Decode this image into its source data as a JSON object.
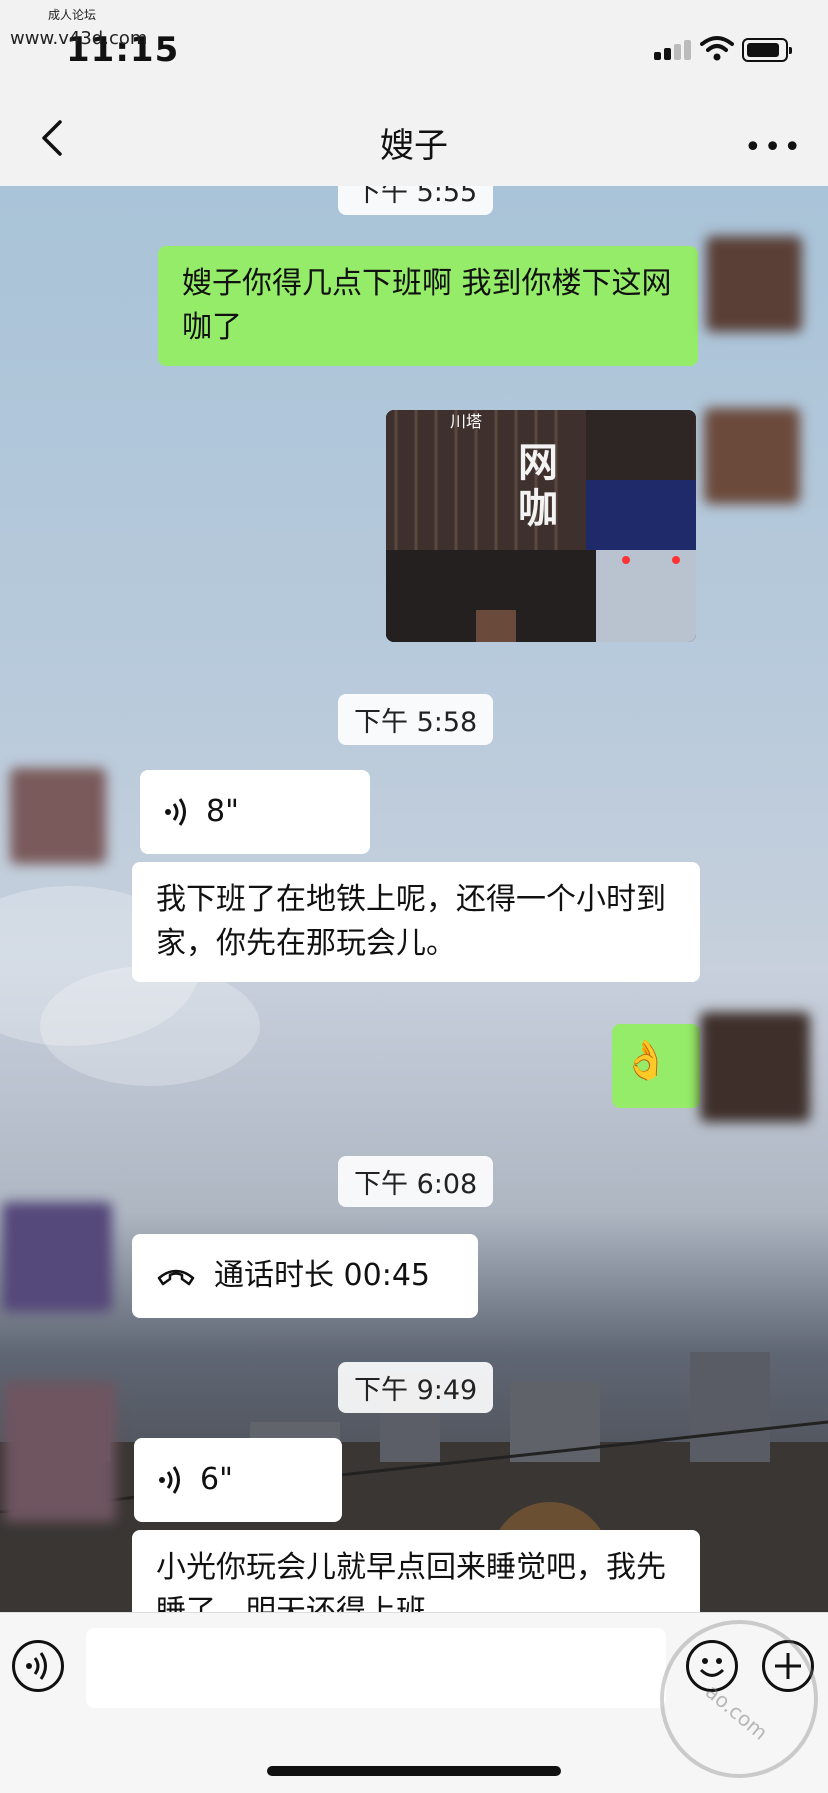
{
  "status": {
    "time": "11:15",
    "site_label": "成人论坛",
    "site_url": "www.v43d.com"
  },
  "nav": {
    "title": "嫂子",
    "back_icon": "chevron-left-icon",
    "more_label": "•••"
  },
  "messages": {
    "ts1": "下午 5:55",
    "m1": "嫂子你得几点下班啊 我到你楼下这网咖了",
    "photo_sign_top": "川塔",
    "photo_sign": "网咖",
    "ts2": "下午 5:58",
    "v1": "8\"",
    "m2": "我下班了在地铁上呢，还得一个小时到家，你先在那玩会儿。",
    "ok_emoji": "👌",
    "ts3": "下午 6:08",
    "call": "通话时长 00:45",
    "ts4": "下午 9:49",
    "v2": "6\"",
    "m3": "小光你玩会儿就早点回来睡觉吧，我先睡了，明天还得上班"
  },
  "watermark": {
    "stamp": "ao.com"
  },
  "colors": {
    "outgoing": "#95ec69",
    "incoming": "#ffffff",
    "bar": "#f2f2f2"
  }
}
